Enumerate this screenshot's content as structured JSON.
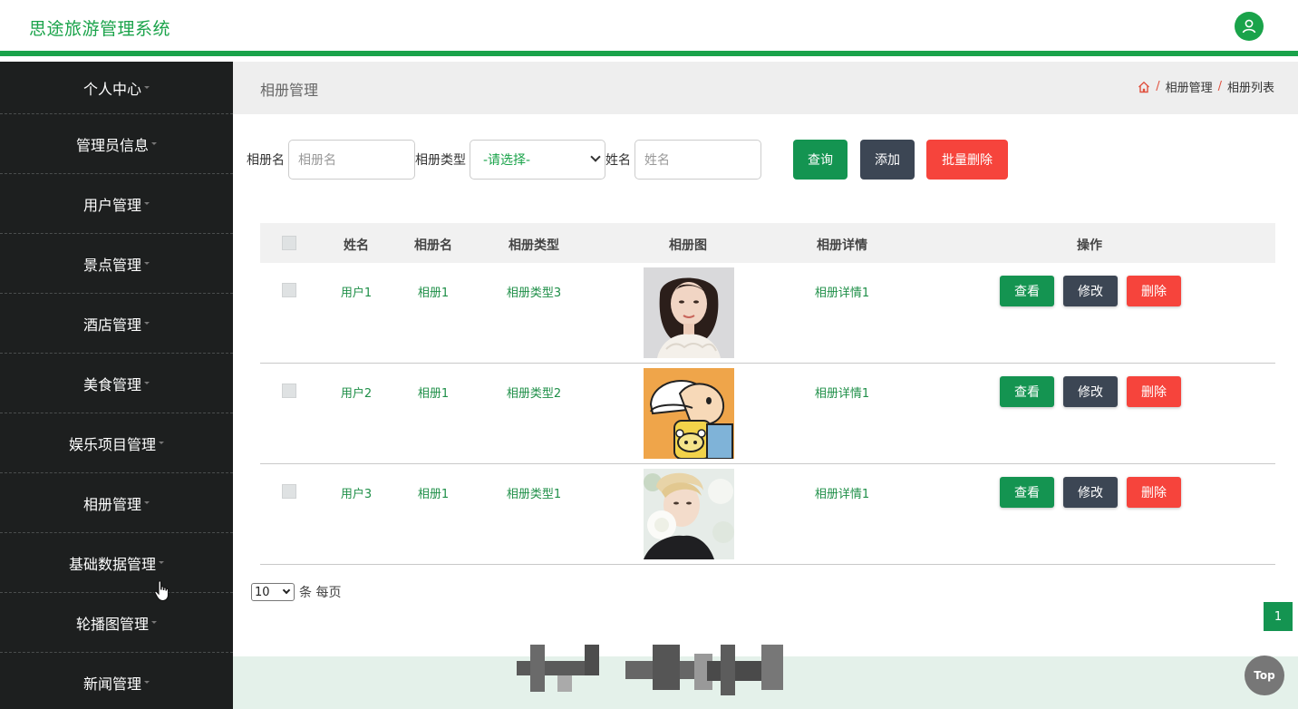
{
  "header": {
    "brand": "思途旅游管理系统"
  },
  "sidebar": {
    "items": [
      {
        "label": "个人中心"
      },
      {
        "label": "管理员信息"
      },
      {
        "label": "用户管理"
      },
      {
        "label": "景点管理"
      },
      {
        "label": "酒店管理"
      },
      {
        "label": "美食管理"
      },
      {
        "label": "娱乐项目管理"
      },
      {
        "label": "相册管理"
      },
      {
        "label": "基础数据管理"
      },
      {
        "label": "轮播图管理"
      },
      {
        "label": "新闻管理"
      }
    ]
  },
  "page": {
    "title": "相册管理",
    "breadcrumb": [
      "相册管理",
      "相册列表"
    ],
    "breadcrumb_sep": "/"
  },
  "search": {
    "album_name_label": "相册名",
    "album_name_placeholder": "相册名",
    "album_type_label": "相册类型",
    "album_type_selected": "-请选择-",
    "name_label": "姓名",
    "name_placeholder": "姓名",
    "query_button": "查询",
    "add_button": "添加",
    "batch_delete_button": "批量删除"
  },
  "table": {
    "columns": [
      "姓名",
      "相册名",
      "相册类型",
      "相册图",
      "相册详情",
      "操作"
    ],
    "rows": [
      {
        "name": "用户1",
        "album": "相册1",
        "type": "相册类型3",
        "detail": "相册详情1",
        "image": "portrait-woman"
      },
      {
        "name": "用户2",
        "album": "相册1",
        "type": "相册类型2",
        "detail": "相册详情1",
        "image": "cartoon-boy"
      },
      {
        "name": "用户3",
        "album": "相册1",
        "type": "相册类型1",
        "detail": "相册详情1",
        "image": "portrait-man-flowers"
      }
    ],
    "actions": {
      "view": "查看",
      "edit": "修改",
      "delete": "删除"
    }
  },
  "pagination": {
    "page_size": "10",
    "page_size_suffix": "条 每页",
    "current_page": "1"
  },
  "top_button": "Top",
  "colors": {
    "accent": "#1aa34a",
    "sidebar_bg": "#1d1f1f",
    "dark_button": "#3c4654",
    "danger": "#f6443c"
  }
}
